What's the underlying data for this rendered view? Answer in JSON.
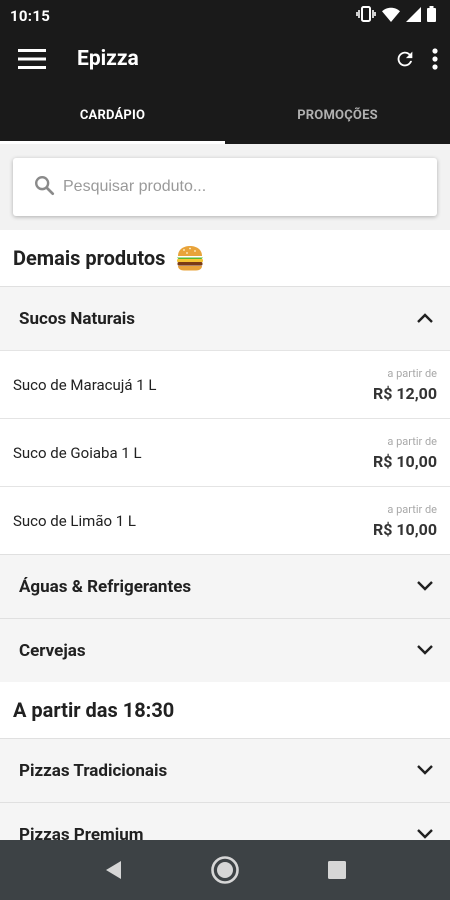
{
  "status_bar": {
    "time": "10:15",
    "icons": [
      "vibrate-icon",
      "wifi-icon",
      "signal-icon",
      "battery-icon"
    ]
  },
  "app_bar": {
    "title": "Epizza",
    "icons": [
      "menu-icon",
      "refresh-icon",
      "more-vert-icon"
    ]
  },
  "tabs": [
    {
      "label": "CARDÁPIO",
      "active": true
    },
    {
      "label": "PROMOÇÕES",
      "active": false
    }
  ],
  "search": {
    "placeholder": "Pesquisar produto...",
    "value": ""
  },
  "sections": [
    {
      "title": "Demais produtos",
      "emoji": "burger-icon",
      "categories": [
        {
          "label": "Sucos Naturais",
          "expanded": true,
          "products": [
            {
              "name": "Suco de Maracujá 1 L",
              "from": "a partir de",
              "price": "R$ 12,00"
            },
            {
              "name": "Suco de Goiaba 1 L",
              "from": "a partir de",
              "price": "R$ 10,00"
            },
            {
              "name": "Suco de Limão 1 L",
              "from": "a partir de",
              "price": "R$ 10,00"
            }
          ]
        },
        {
          "label": "Águas & Refrigerantes",
          "expanded": false
        },
        {
          "label": "Cervejas",
          "expanded": false
        }
      ]
    },
    {
      "title": "A partir das 18:30",
      "categories": [
        {
          "label": "Pizzas Tradicionais",
          "expanded": false
        },
        {
          "label": "Pizzas Premium",
          "expanded": false
        }
      ]
    }
  ],
  "nav_bar": {
    "icons": [
      "back-icon",
      "home-icon",
      "recents-icon"
    ]
  },
  "colors": {
    "app_bar_bg": "#1a1a1a",
    "nav_bar_bg": "#3d4245",
    "background": "#f2f2f2"
  }
}
